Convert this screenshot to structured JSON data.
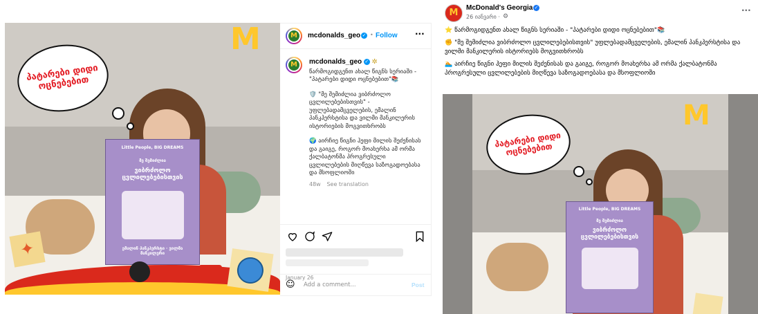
{
  "instagram": {
    "handle": "mcdonalds_geo",
    "follow_label": "Follow",
    "bullet": "•",
    "caption_handle": "mcdonalds_geo",
    "caption_lines": [
      "წარმოგიდგენთ ახალ წიგნს სერიაში - \"პატარები დიდი ოცნებებით\"📚",
      "🛡️ \"მე შემიძლია ვიბრძოლო ცვლილებებისთვის\" - უფლებადამცველების, ემალინ პანკჰერსტისა და ვილმი მანკილერის ისტორიების მოგვითხრობს",
      "🌍 აირჩიე წიგნი ჰეფი მილის შეძენისას და გაიგე, როგორ მოახერხა ამ ორმა ქალბატონმა პროგრესული ცვლილებების მიღწევა საზოგადოებასა და მსოფლიოში"
    ],
    "time_ago": "48w",
    "see_translation": "See translation",
    "date": "January 26",
    "add_comment_placeholder": "Add a comment...",
    "post_label": "Post"
  },
  "facebook": {
    "page_name": "McDonald's Georgia",
    "date": "26 იანვარი ·",
    "more_label": "···",
    "lines": [
      "⭐ წარმოგიდგენთ ახალ წიგნს სერიაში - \"პატარები დიდი ოცნებებით\"📚",
      "✊ \"მე შემიძლია ვიბრძოლო ცვლილებებისთვის\" უფლებადამცველების, ემალინ პანკჰერსტისა და ვილმი მანკილერის ისტორიებს მოგვითხრობს",
      "🏊 აირჩიე წიგნი ჰეფი მილის შეძენისას და გაიგე, როგორ მოახერხა ამ ორმა ქალბატონმა პროგრესული ცვლილებების მიღწევა საზოგადოებასა და მსოფლიოში"
    ]
  },
  "illustration": {
    "bubble_text": "პატარები დიდი ოცნებებით",
    "logo_char": "M",
    "book_series": "Little People, BIG DREAMS",
    "book_title": "ვიბრძოლო ცვლილებებისთვის",
    "book_subtitle": "მე შემიძლია",
    "book_names": "ემალინ პანკჰერსტი · ვილმა მანკილერი"
  },
  "colors": {
    "brand_red": "#da291c",
    "brand_yellow": "#ffc72c",
    "ig_blue": "#0095f6",
    "fb_blue": "#1877f2"
  }
}
